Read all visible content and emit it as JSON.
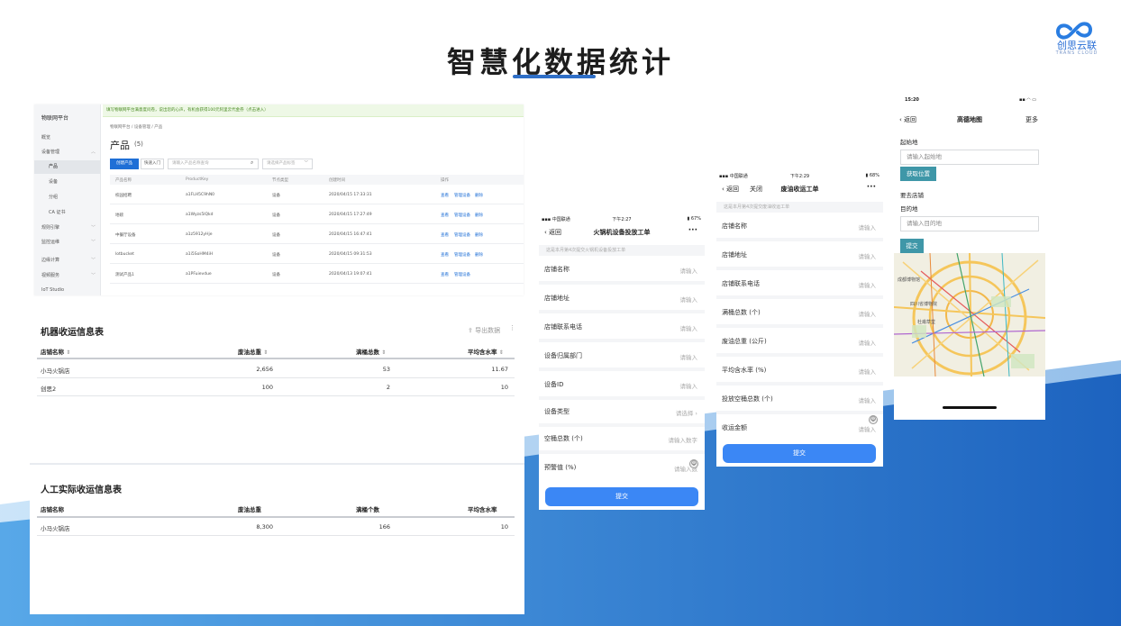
{
  "header": {
    "title": "智慧化数据统计"
  },
  "logo": {
    "text": "创思云联",
    "subtitle": "TRANS CLOUD"
  },
  "colors": {
    "accent": "#2f6fc7",
    "wave_dark": "#1f66c0",
    "wave_light": "#5aa6e6",
    "button_blue": "#3b87f5",
    "map_button": "#3f97a8"
  },
  "console": {
    "brand": "物联网平台",
    "notice": "填写物联网平台满意度问卷，说出您的心声，有机会获得100元阿里云代金券（点击进入）",
    "breadcrumb": "物联网平台  /  设备管理  /  产品",
    "page_title": "产品",
    "count": "(5)",
    "create_button": "创建产品",
    "quick_button": "快速入门",
    "search_placeholder": "请输入产品名称查询",
    "select_placeholder": "请选择产品标签",
    "nav": [
      {
        "label": "概览"
      },
      {
        "label": "设备管理"
      },
      {
        "label": "产品"
      },
      {
        "label": "设备"
      },
      {
        "label": "分组"
      },
      {
        "label": "CA 证书"
      },
      {
        "label": "规则引擎"
      },
      {
        "label": "监控运维"
      },
      {
        "label": "边缘计算"
      },
      {
        "label": "视频服务"
      },
      {
        "label": "IoT Studio"
      }
    ],
    "columns": [
      "产品名称",
      "ProductKey",
      "节点类型",
      "创建时间",
      "操作"
    ],
    "rows": [
      {
        "name": "校园招聘",
        "key": "a1FLH5C9hN0",
        "type": "设备",
        "time": "2020/04/15 17:33:31"
      },
      {
        "name": "地磅",
        "key": "a1Wyzs5lQkd",
        "type": "设备",
        "time": "2020/04/15 17:27:49"
      },
      {
        "name": "中餐厅设备",
        "key": "a1z5912yHje",
        "type": "设备",
        "time": "2020/04/15 16:47:41"
      },
      {
        "name": "lotbucket",
        "key": "a1i5SoHM4iH",
        "type": "设备",
        "time": "2020/04/15 09:31:53"
      },
      {
        "name": "测试产品1",
        "key": "a1PFuievdue",
        "type": "设备",
        "time": "2020/04/13 19:07:41"
      }
    ],
    "actions": {
      "view": "查看",
      "manage": "管理设备",
      "delete": "删除"
    }
  },
  "machine_table": {
    "title": "机器收运信息表",
    "export": "导出数据",
    "columns": [
      "店铺名称",
      "废油总重",
      "满桶总数",
      "平均含水率"
    ],
    "rows": [
      {
        "shop": "小马火锅店",
        "weight": "2,656",
        "buckets": "53",
        "water": "11.67"
      },
      {
        "shop": "创思2",
        "weight": "100",
        "buckets": "2",
        "water": "10"
      }
    ]
  },
  "manual_table": {
    "title": "人工实际收运信息表",
    "columns": [
      "店铺名称",
      "废油总重",
      "满桶个数",
      "平均含水率"
    ],
    "rows": [
      {
        "shop": "小马火锅店",
        "weight": "8,300",
        "buckets": "166",
        "water": "10"
      }
    ]
  },
  "phone1": {
    "carrier": "中国联通",
    "time": "下午2:27",
    "battery": "67%",
    "back": "返回",
    "title": "火锅机设备投放工单",
    "hint": "这是本月第4次提交火锅机设备投放工单",
    "fields": [
      {
        "label": "店铺名称",
        "placeholder": "请输入"
      },
      {
        "label": "店铺地址",
        "placeholder": "请输入"
      },
      {
        "label": "店铺联系电话",
        "placeholder": "请输入"
      },
      {
        "label": "设备归属部门",
        "placeholder": "请输入"
      },
      {
        "label": "设备ID",
        "placeholder": "请输入"
      },
      {
        "label": "设备类型",
        "placeholder": "请选择"
      },
      {
        "label": "空桶总数 (个)",
        "placeholder": "请输入数字"
      },
      {
        "label": "预警值 (%)",
        "placeholder": "请输入数"
      }
    ],
    "submit": "提交"
  },
  "phone2": {
    "carrier": "中国联通",
    "time": "下午2:29",
    "battery": "68%",
    "back": "返回",
    "close": "关闭",
    "title": "废油收运工单",
    "hint": "这是本月第4次提交废油收运工单",
    "fields": [
      {
        "label": "店铺名称",
        "placeholder": "请输入"
      },
      {
        "label": "店铺地址",
        "placeholder": "请输入"
      },
      {
        "label": "店铺联系电话",
        "placeholder": "请输入"
      },
      {
        "label": "满桶总数 (个)",
        "placeholder": "请输入"
      },
      {
        "label": "废油总重 (公斤)",
        "placeholder": "请输入"
      },
      {
        "label": "平均含水率 (%)",
        "placeholder": "请输入"
      },
      {
        "label": "投放空桶总数 (个)",
        "placeholder": "请输入"
      },
      {
        "label": "收运金额",
        "placeholder": "请输入"
      }
    ],
    "submit": "提交"
  },
  "phone3": {
    "time": "15:20",
    "back": "返回",
    "title": "高德地图",
    "more": "更多",
    "origin_label": "起始地",
    "origin_placeholder": "请输入起始地",
    "locate_button": "获取位置",
    "goto_label": "要去店铺",
    "dest_label": "目的地",
    "dest_placeholder": "请输入目的地",
    "submit": "提交",
    "map_labels": [
      "成都博物馆",
      "四川省博物院",
      "杜甫草堂"
    ]
  }
}
